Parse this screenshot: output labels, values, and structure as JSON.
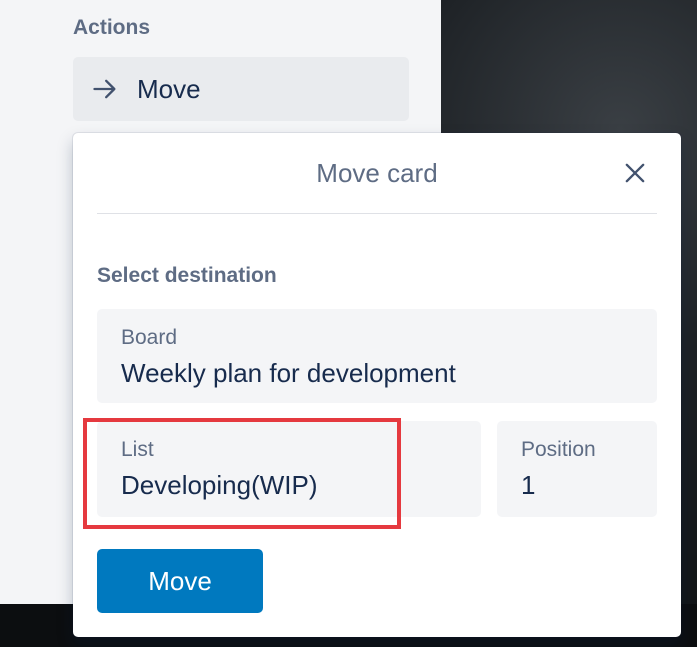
{
  "sidebar": {
    "section_title": "Actions",
    "move_action": {
      "label": "Move",
      "icon": "arrow-right-icon"
    }
  },
  "popover": {
    "title": "Move card",
    "close_icon": "close-icon",
    "section_title": "Select destination",
    "board": {
      "label": "Board",
      "value": "Weekly plan for development"
    },
    "list": {
      "label": "List",
      "value": "Developing(WIP)"
    },
    "position": {
      "label": "Position",
      "value": "1"
    },
    "submit_label": "Move"
  },
  "colors": {
    "primary": "#0079bf",
    "highlight": "#e5393f",
    "text_dark": "#172b4d",
    "text_muted": "#5e6c84"
  }
}
